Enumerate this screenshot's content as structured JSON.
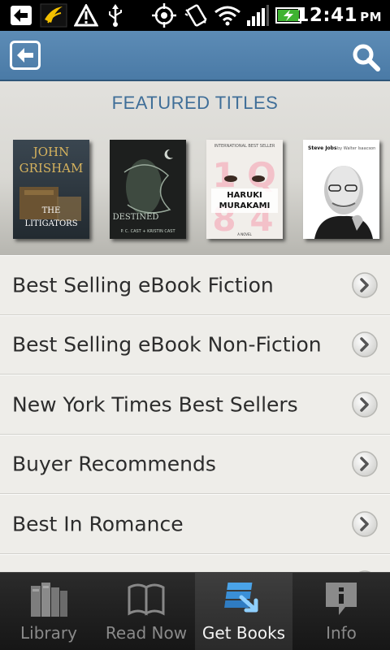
{
  "status_bar": {
    "time": "12:41",
    "ampm": "PM",
    "icons": [
      "back-arrow-notification-icon",
      "sprint-logo-icon",
      "warning-icon",
      "usb-icon",
      "gps-icon",
      "vibrate-icon",
      "wifi-icon",
      "signal-icon",
      "battery-charging-icon"
    ]
  },
  "header": {
    "back_icon": "back-arrow-icon",
    "search_icon": "search-icon"
  },
  "featured": {
    "title": "FEATURED TITLES",
    "books": [
      {
        "cover_lines": [
          "JOHN",
          "GRISHAM",
          "THE",
          "LITIGATORS"
        ],
        "accent": "#c9a552"
      },
      {
        "cover_lines": [
          "DESTINED",
          "P. C. CAST + KRISTIN CAST"
        ],
        "accent": "#7b8a7c"
      },
      {
        "cover_lines": [
          "INTERNATIONAL BEST SELLER",
          "HARUKI",
          "MURAKAMI",
          "1Q84",
          "A NOVEL"
        ],
        "accent": "#d84d6a"
      },
      {
        "cover_lines": [
          "Steve Jobs",
          "by Walter Isaacson"
        ],
        "accent": "#ffffff"
      }
    ]
  },
  "list": {
    "items": [
      {
        "label": "Best Selling eBook Fiction"
      },
      {
        "label": "Best Selling eBook Non-Fiction"
      },
      {
        "label": "New York Times Best Sellers"
      },
      {
        "label": "Buyer Recommends"
      },
      {
        "label": "Best In Romance"
      },
      {
        "label": ""
      }
    ]
  },
  "tabs": [
    {
      "label": "Library",
      "icon": "books-icon",
      "active": false
    },
    {
      "label": "Read Now",
      "icon": "open-book-icon",
      "active": false
    },
    {
      "label": "Get Books",
      "icon": "download-books-icon",
      "active": true
    },
    {
      "label": "Info",
      "icon": "info-icon",
      "active": false
    }
  ],
  "colors": {
    "app_bar": "#4e7eaa",
    "featured_title": "#3f6e98",
    "tab_active_label": "#f4f4f4",
    "tab_inactive_label": "#8a8a8a"
  }
}
